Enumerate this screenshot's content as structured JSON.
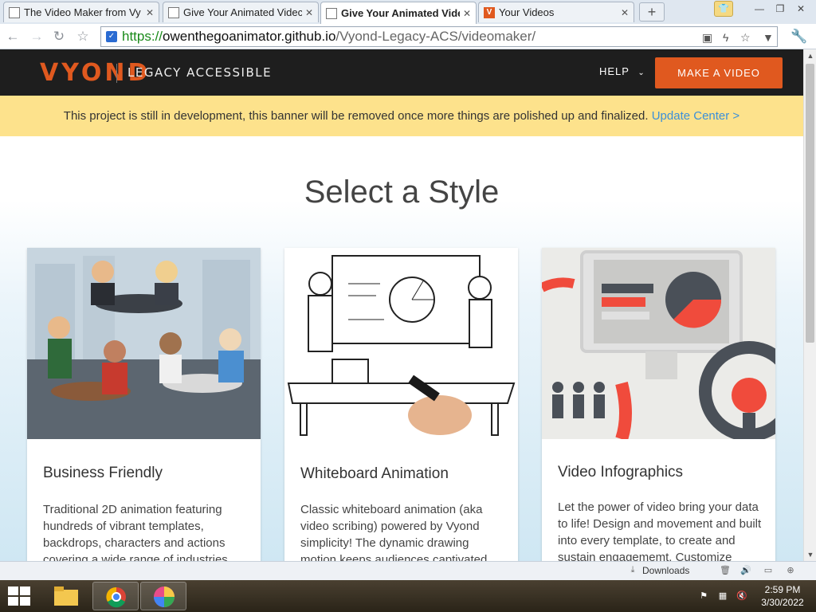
{
  "browser": {
    "tabs": [
      {
        "title": "The Video Maker from Vy",
        "icon": "doc",
        "active": false
      },
      {
        "title": "Give Your Animated Videc",
        "icon": "doc",
        "active": false
      },
      {
        "title": "Give Your Animated Vide",
        "icon": "doc",
        "active": true
      },
      {
        "title": "Your Videos",
        "icon": "vyond",
        "active": false
      }
    ],
    "new_tab": "+",
    "url_scheme": "https://",
    "url_host": "owenthegoanimator.github.io",
    "url_path": "/Vyond-Legacy-ACS/videomaker/"
  },
  "header": {
    "logo": "VYOND",
    "logo_sub": "LEGACY ACCESSIBLE",
    "help": "HELP",
    "cta": "MAKE A VIDEO"
  },
  "banner": {
    "text": "This project is still in development, this banner will be removed once more things are polished up and finalized.",
    "link": "Update Center >"
  },
  "main": {
    "title": "Select a Style",
    "cards": [
      {
        "title": "Business Friendly",
        "desc": "Traditional 2D animation featuring hundreds of vibrant templates, backdrops, characters and actions covering a wide range of industries."
      },
      {
        "title": "Whiteboard Animation",
        "desc": "Classic whiteboard animation (aka video scribing) powered by Vyond simplicity! The dynamic drawing motion keeps audiences captivated."
      },
      {
        "title": "Video Infographics",
        "desc": "Let the power of video bring your data to life! Design and movement and built into every template, to create and sustain engagememt. Customize"
      }
    ]
  },
  "statusbar": {
    "downloads": "Downloads"
  },
  "taskbar": {
    "time": "2:59 PM",
    "date": "3/30/2022"
  },
  "colors": {
    "brand": "#e0591f",
    "banner": "#fde28c",
    "link": "#3b8fd9"
  }
}
